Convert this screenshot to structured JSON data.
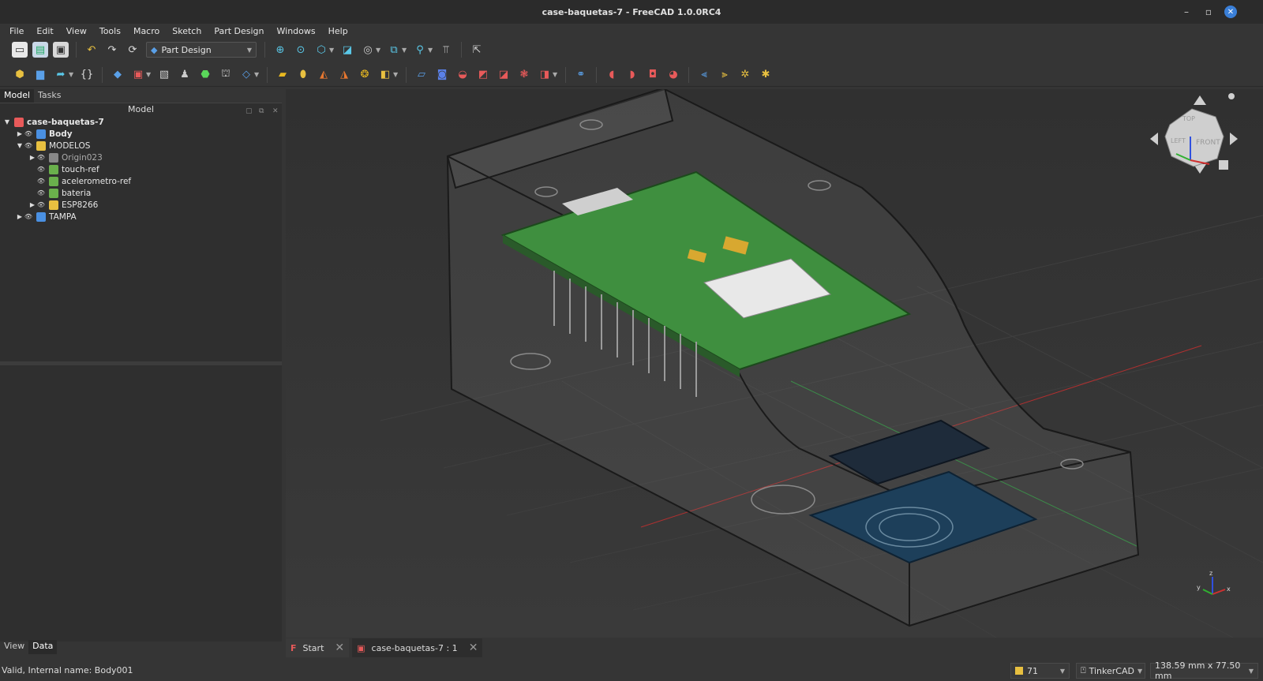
{
  "window": {
    "title": "case-baquetas-7 - FreeCAD 1.0.0RC4"
  },
  "menu": [
    "File",
    "Edit",
    "View",
    "Tools",
    "Macro",
    "Sketch",
    "Part Design",
    "Windows",
    "Help"
  ],
  "toolbar": {
    "workbench": "Part Design"
  },
  "combo": {
    "tabs": [
      "Model",
      "Tasks"
    ],
    "header": "Model"
  },
  "tree": [
    {
      "label": "case-baquetas-7",
      "level": 0,
      "expanded": true,
      "bold": true,
      "icon": "document-icon"
    },
    {
      "label": "Body",
      "level": 1,
      "expanded": false,
      "bold": true,
      "icon": "body-icon"
    },
    {
      "label": "MODELOS",
      "level": 1,
      "expanded": true,
      "bold": false,
      "icon": "part-icon"
    },
    {
      "label": "Origin023",
      "level": 2,
      "expanded": false,
      "bold": false,
      "icon": "origin-icon",
      "dim": true
    },
    {
      "label": "touch-ref",
      "level": 2,
      "bold": false,
      "icon": "shape-icon"
    },
    {
      "label": "acelerometro-ref",
      "level": 2,
      "bold": false,
      "icon": "shape-icon"
    },
    {
      "label": "bateria",
      "level": 2,
      "bold": false,
      "icon": "shape-icon"
    },
    {
      "label": "ESP8266",
      "level": 2,
      "expanded": false,
      "bold": false,
      "icon": "part-icon"
    },
    {
      "label": "TAMPA",
      "level": 1,
      "expanded": false,
      "bold": false,
      "icon": "body-icon"
    }
  ],
  "property_tabs": [
    "View",
    "Data"
  ],
  "doc_tabs": [
    {
      "label": "Start"
    },
    {
      "label": "case-baquetas-7 : 1"
    }
  ],
  "status": {
    "message": "Valid, Internal name: Body001",
    "count": "71",
    "nav_style": "TinkerCAD",
    "dimensions": "138.59 mm x 77.50 mm"
  },
  "navcube": {
    "faces": [
      "TOP",
      "FRONT",
      "LEFT"
    ]
  },
  "axis": {
    "labels": [
      "x",
      "y",
      "z"
    ]
  },
  "colors": {
    "accent": "#3a7fd8",
    "pcb": "#3f8f3f",
    "module": "#1d3f5a"
  }
}
